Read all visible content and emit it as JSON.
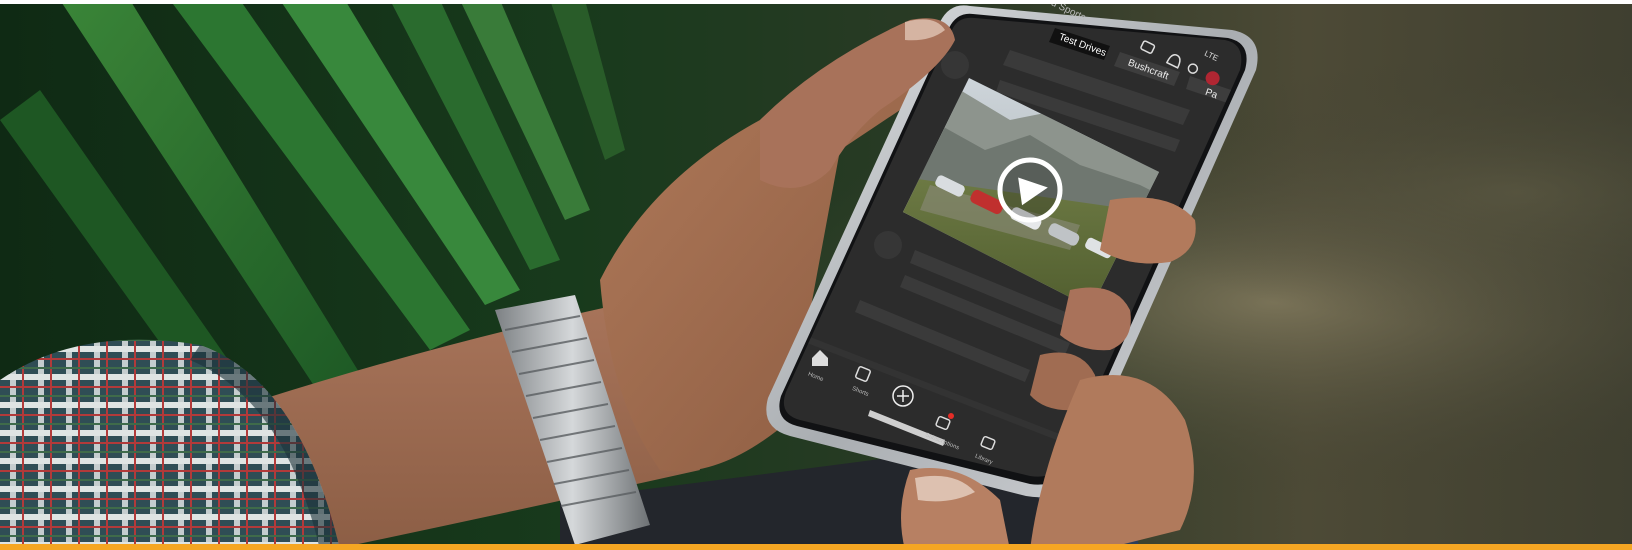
{
  "phone": {
    "channel_name": "d Sports",
    "chip_selected": "Test Drives",
    "chip_2": "Bushcraft",
    "chip_3": "Pa",
    "status_network": "LTE"
  },
  "nav": {
    "home_label": "Home",
    "shorts_label": "Shorts",
    "subscriptions_label": "Subscriptions",
    "library_label": "Library"
  },
  "video": {
    "state": "paused",
    "overlay_icon": "play-icon"
  },
  "colors": {
    "accent_strip": "#f5a623",
    "screen_bg": "#2c2c2c",
    "phone_frame": "#c9ccd0"
  }
}
